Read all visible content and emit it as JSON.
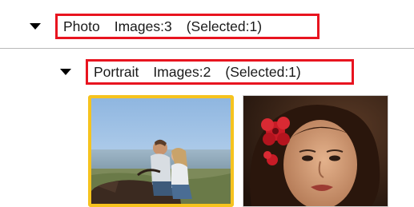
{
  "tree": {
    "groups": [
      {
        "name": "Photo",
        "images": "Images:3",
        "selected": "(Selected:1)"
      },
      {
        "name": "Portrait",
        "images": "Images:2",
        "selected": "(Selected:1)"
      }
    ]
  },
  "thumbnails": [
    {
      "name": "couple-photo",
      "selected": true
    },
    {
      "name": "woman-with-flower-photo",
      "selected": false
    }
  ],
  "colors": {
    "highlight_border": "#e8141f",
    "selected_thumbnail_border": "#f6c31e",
    "divider": "#b9b9b9"
  },
  "icons": {
    "expand": "triangle-down-icon"
  }
}
